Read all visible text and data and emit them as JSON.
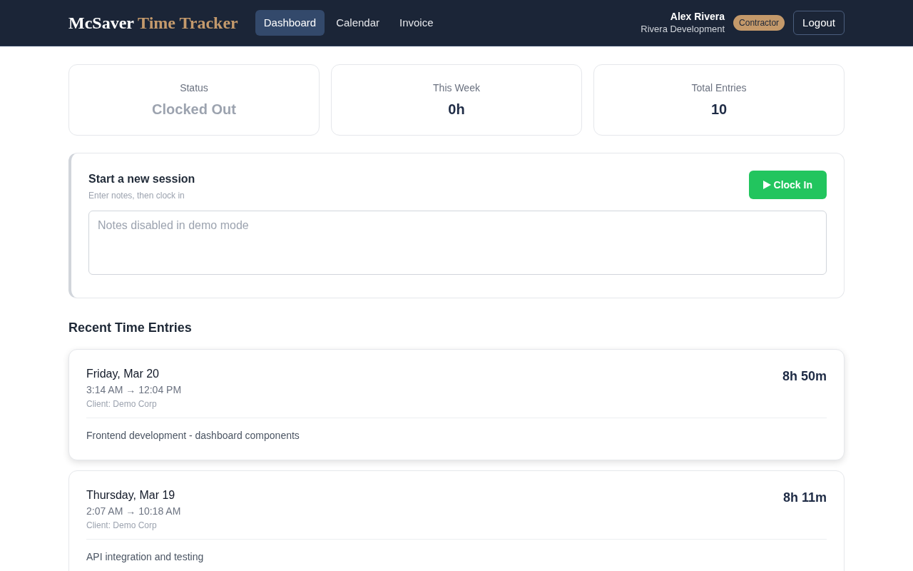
{
  "header": {
    "logo": {
      "primary": "McSaver",
      "accent": "Time Tracker"
    },
    "tabs": [
      {
        "label": "Dashboard",
        "selected": true
      },
      {
        "label": "Calendar",
        "selected": false
      },
      {
        "label": "Invoice",
        "selected": false
      }
    ],
    "user": {
      "name": "Alex Rivera",
      "company": "Rivera Development",
      "role_badge": "Contractor"
    },
    "logout_button": "Logout"
  },
  "stats": [
    {
      "label": "Status",
      "value": "Clocked Out",
      "muted": true
    },
    {
      "label": "This Week",
      "value": "0h",
      "muted": false
    },
    {
      "label": "Total Entries",
      "value": "10",
      "muted": false
    }
  ],
  "session": {
    "title": "Start a new session",
    "hint": "Enter notes, then clock in",
    "clock_in_button": "Clock In",
    "notes": {
      "placeholder": "Notes disabled in demo mode"
    }
  },
  "recent_entries": {
    "title": "Recent Time Entries",
    "entries": [
      {
        "date": "Friday, Mar 20",
        "time_range": "3:14 AM → 12:04 PM",
        "client": "Client: Demo Corp",
        "duration": "8h 50m",
        "notes": "Frontend development - dashboard components",
        "highlighted": true
      },
      {
        "date": "Thursday, Mar 19",
        "time_range": "2:07 AM → 10:18 AM",
        "client": "Client: Demo Corp",
        "duration": "8h 11m",
        "notes": "API integration and testing",
        "highlighted": false
      }
    ]
  }
}
